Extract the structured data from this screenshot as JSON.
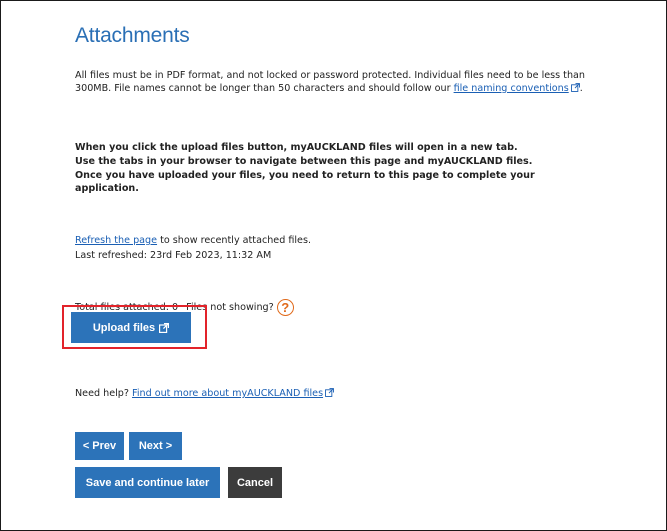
{
  "section": {
    "title": "Attachments"
  },
  "intro": {
    "text": "All files must be in PDF format, and not locked or password protected. Individual files need to be less than 300MB. File names cannot be longer than 50 characters and should follow our ",
    "link": "file naming conventions",
    "suffix": "."
  },
  "note": {
    "line1": "When you click the upload files button, myAUCKLAND files will open in a new tab.",
    "line2": "Use the tabs in your browser to navigate between this page and myAUCKLAND files.",
    "line3": "Once you have uploaded your files, you need to return to this page to complete your application."
  },
  "refresh": {
    "link": "Refresh the page",
    "text": " to show recently attached files.",
    "last_refreshed": "Last refreshed: 23rd Feb 2023, 11:32 AM"
  },
  "files": {
    "total": "Total files attached: 0",
    "not_showing": "Files not showing?",
    "help_icon": "?"
  },
  "upload": {
    "label": "Upload files"
  },
  "help": {
    "prefix": "Need help? ",
    "link": "Find out more about myAUCKLAND files"
  },
  "nav": {
    "prev": "< Prev",
    "next": "Next >",
    "save": "Save and continue later",
    "cancel": "Cancel"
  },
  "colors": {
    "primary": "#2c73b9",
    "title": "#2a6fb5",
    "link": "#1a5fb4",
    "dark_button": "#3c3c3c",
    "highlight": "#e2232a",
    "help_icon": "#e06a1b"
  }
}
